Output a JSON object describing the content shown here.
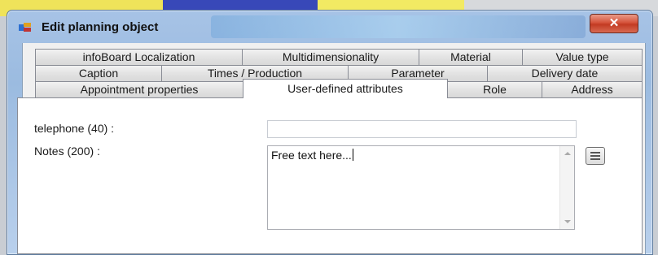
{
  "window": {
    "title": "Edit planning object",
    "close_glyph": "✕"
  },
  "tabs": {
    "row1": [
      "infoBoard Localization",
      "Multidimensionality",
      "Material",
      "Value type"
    ],
    "row2": [
      "Caption",
      "Times / Production",
      "Parameter",
      "Delivery date"
    ],
    "row3": [
      "Appointment properties",
      "User-defined attributes",
      "Role",
      "Address"
    ],
    "active": "User-defined attributes"
  },
  "form": {
    "telephone_label": "telephone (40) :",
    "telephone_value": "",
    "notes_label": "Notes (200) :",
    "notes_value": "Free text here..."
  },
  "icons": {
    "app": "planning-app-icon",
    "close": "close-icon",
    "notes_button": "text-editor-icon"
  }
}
